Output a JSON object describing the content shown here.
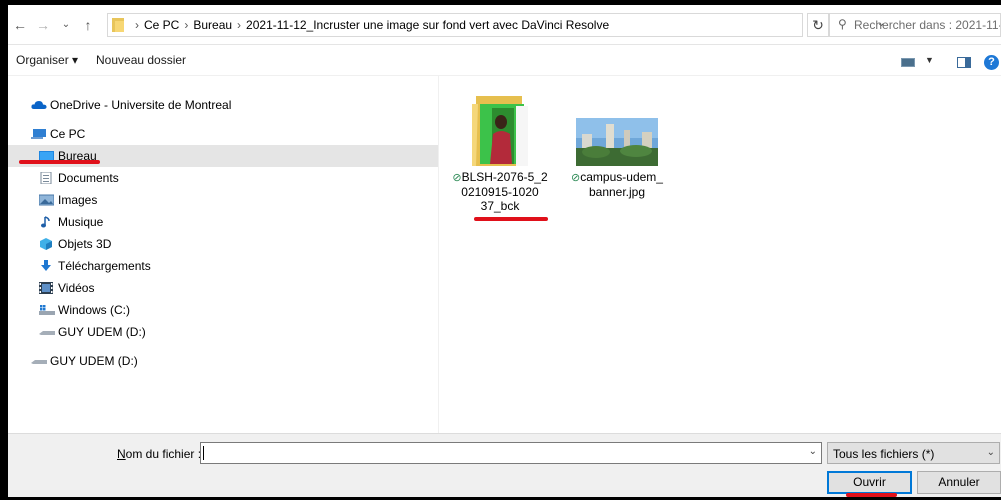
{
  "address_bar": {
    "crumbs": [
      "Ce PC",
      "Bureau",
      "2021-11-12_Incruster une image sur fond vert avec DaVinci Resolve"
    ],
    "search_placeholder": "Rechercher dans : 2021-11-1..."
  },
  "toolbar": {
    "organize_label": "Organiser ▾",
    "new_folder_label": "Nouveau dossier"
  },
  "nav": {
    "onedrive": "OneDrive - Universite de Montreal",
    "this_pc": "Ce PC",
    "desktop": "Bureau",
    "documents": "Documents",
    "pictures": "Images",
    "music": "Musique",
    "objects3d": "Objets 3D",
    "downloads": "Téléchargements",
    "videos": "Vidéos",
    "windows_c": "Windows (C:)",
    "usb_d_1": "GUY UDEM (D:)",
    "usb_d_2": "GUY UDEM (D:)"
  },
  "files": [
    {
      "name": "BLSH-2076-5_2\n0210915-1020\n37_bck",
      "type": "folder"
    },
    {
      "name": "campus-udem_\nbanner.jpg",
      "type": "image"
    }
  ],
  "bottom": {
    "filename_label_mnemonic": "N",
    "filename_label_rest": "om du fichier :",
    "filename_value": "",
    "filetype": "Tous les fichiers (*)",
    "open_label": "Ouvrir",
    "cancel_label": "Annuler"
  },
  "colors": {
    "accent": "#0078d7",
    "annotation_red": "#e0101a",
    "selection": "#e5e5e5"
  }
}
